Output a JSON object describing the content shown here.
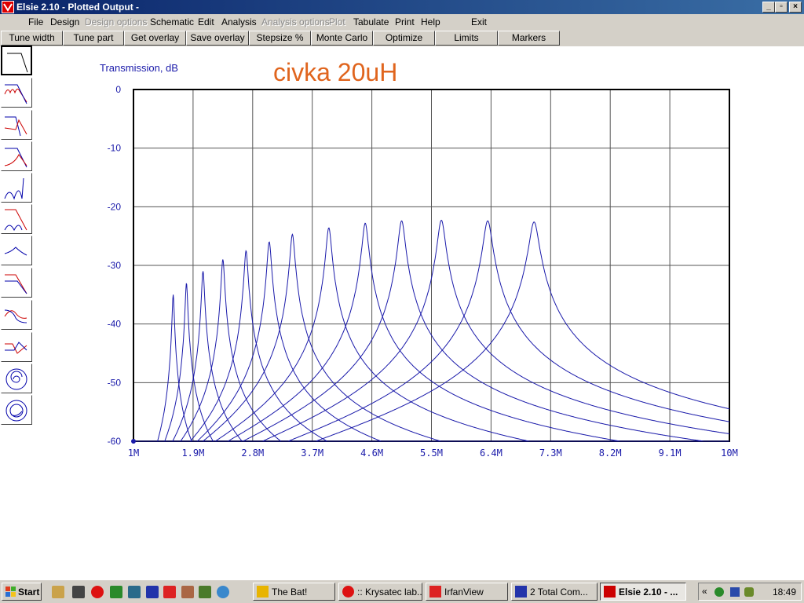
{
  "window": {
    "title": "Elsie 2.10 - Plotted Output -"
  },
  "menu": [
    {
      "label": "File",
      "enabled": true
    },
    {
      "label": "Design",
      "enabled": true
    },
    {
      "label": "Design options",
      "enabled": false
    },
    {
      "label": "Schematic",
      "enabled": true
    },
    {
      "label": "Edit",
      "enabled": true
    },
    {
      "label": "Analysis",
      "enabled": true
    },
    {
      "label": "Analysis options",
      "enabled": false
    },
    {
      "label": "Plot",
      "enabled": false
    },
    {
      "label": "Tabulate",
      "enabled": true
    },
    {
      "label": "Print",
      "enabled": true
    },
    {
      "label": "Help",
      "enabled": true
    },
    {
      "label": "Exit",
      "enabled": true
    }
  ],
  "toolbar": [
    "Tune width",
    "Tune part",
    "Get overlay",
    "Save overlay",
    "Stepsize %",
    "Monte Carlo",
    "Optimize",
    "Limits",
    "Markers"
  ],
  "sidebar": {
    "icons": [
      "lowpass-plot-icon",
      "ripple-plot-icon",
      "phase-plot-icon",
      "group-delay-plot-icon",
      "impulse-plot-icon",
      "step-plot-icon",
      "smooth-plot-icon",
      "rolloff-plot-icon",
      "bandpass-plot-icon",
      "notch-plot-icon",
      "smith-chart-icon",
      "polar-chart-icon"
    ],
    "active_index": 0
  },
  "chart_data": {
    "type": "line",
    "title": "civka 20uH",
    "ylabel": "Transmission, dB",
    "xlabel": "",
    "xlim": [
      1000000,
      10000000
    ],
    "ylim": [
      -60,
      0
    ],
    "grid": true,
    "color": "#1a1aaa",
    "xticks": [
      "1M",
      "1.9M",
      "2.8M",
      "3.7M",
      "4.6M",
      "5.5M",
      "6.4M",
      "7.3M",
      "8.2M",
      "9.1M",
      "10M"
    ],
    "yticks": [
      "0",
      "-10",
      "-20",
      "-30",
      "-40",
      "-50",
      "-60"
    ],
    "series": [
      {
        "peak_mhz": 1.6,
        "peak_db": -35.0
      },
      {
        "peak_mhz": 1.8,
        "peak_db": -33.0
      },
      {
        "peak_mhz": 2.05,
        "peak_db": -31.0
      },
      {
        "peak_mhz": 2.35,
        "peak_db": -29.0
      },
      {
        "peak_mhz": 2.7,
        "peak_db": -27.5
      },
      {
        "peak_mhz": 3.05,
        "peak_db": -26.0
      },
      {
        "peak_mhz": 3.4,
        "peak_db": -24.7
      },
      {
        "peak_mhz": 3.95,
        "peak_db": -23.6
      },
      {
        "peak_mhz": 4.5,
        "peak_db": -22.8
      },
      {
        "peak_mhz": 5.05,
        "peak_db": -22.4
      },
      {
        "peak_mhz": 5.65,
        "peak_db": -22.3
      },
      {
        "peak_mhz": 6.35,
        "peak_db": -22.4
      },
      {
        "peak_mhz": 7.05,
        "peak_db": -22.6
      }
    ]
  },
  "taskbar": {
    "start_label": "Start",
    "quicklaunch": [
      "winamp-icon",
      "media-icon",
      "opera-icon",
      "frog-icon",
      "shield-icon",
      "floppy-icon",
      "irfanview-icon",
      "info-icon",
      "game-icon",
      "refresh-icon"
    ],
    "tasks": [
      {
        "label": "The Bat!",
        "icon": "thebat-icon",
        "active": false
      },
      {
        "label": ":: Krysatec lab...",
        "icon": "opera-icon",
        "active": false
      },
      {
        "label": "IrfanView",
        "icon": "irfanview-icon",
        "active": false
      },
      {
        "label": "2 Total Com...",
        "icon": "floppy-icon",
        "active": false
      },
      {
        "label": "Elsie 2.10 - ...",
        "icon": "elsie-icon",
        "active": true
      }
    ],
    "clock": "18:49"
  }
}
